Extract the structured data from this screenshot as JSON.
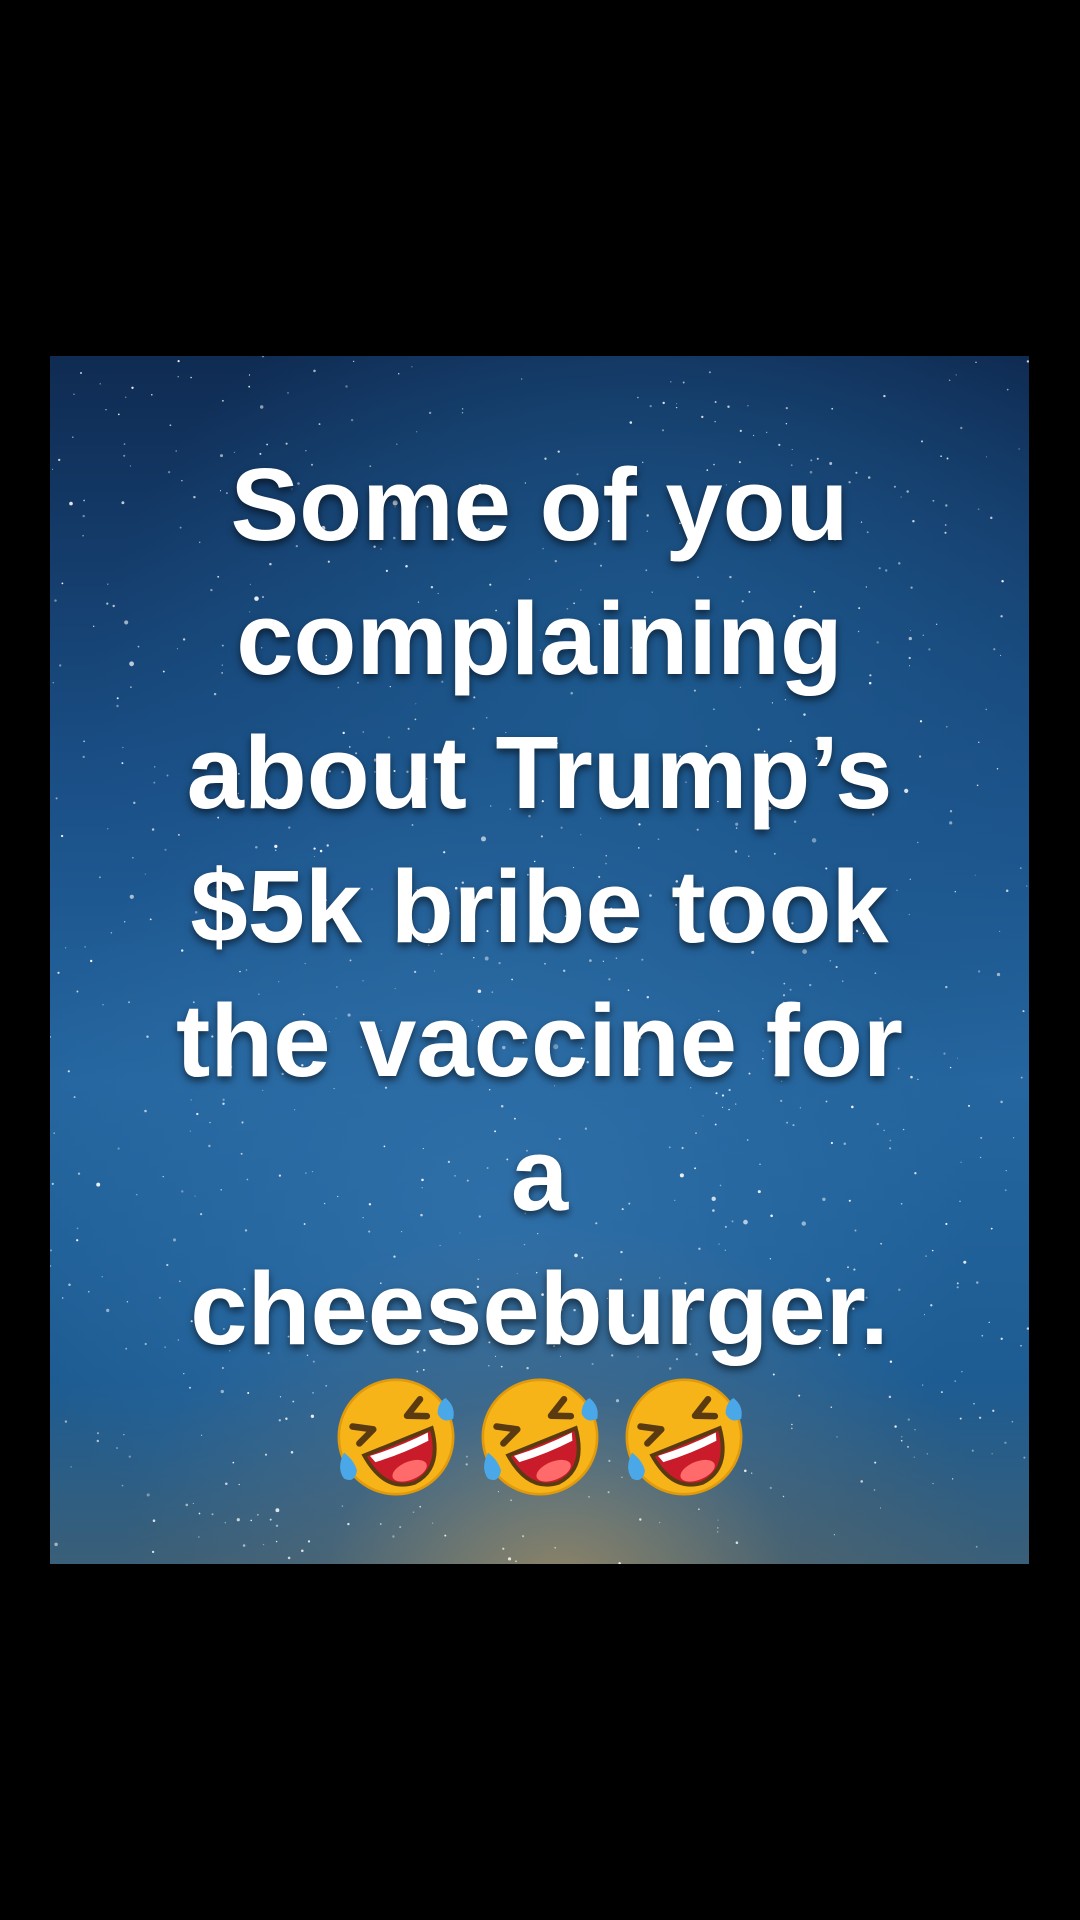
{
  "meme": {
    "caption_lines": [
      "Some of you",
      "complaining",
      "about Trump’s",
      "$5k bribe took",
      "the vaccine for",
      "a",
      "cheeseburger."
    ],
    "emojis": [
      "rolling-on-floor-laughing-icon",
      "rolling-on-floor-laughing-icon",
      "rolling-on-floor-laughing-icon"
    ]
  },
  "colors": {
    "background": "#000000",
    "caption_text": "#ffffff",
    "sky_dark": "#0f2b52",
    "sky_mid": "#2566a0",
    "emoji_face": "#f7b418",
    "emoji_mouth": "#c91b2a",
    "emoji_tear": "#4aa8e8"
  }
}
